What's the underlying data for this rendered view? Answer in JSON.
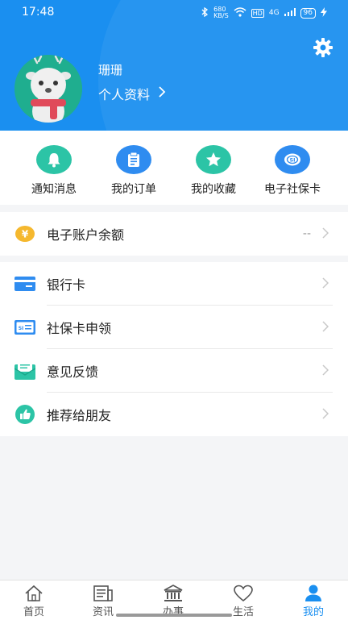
{
  "status_bar": {
    "time": "17:48",
    "network_speed": "680\nKB/S",
    "hd": "HD",
    "signal": "4G",
    "battery": "96"
  },
  "header": {
    "username": "珊珊",
    "profile_link": "个人资料",
    "settings_icon": "gear-icon"
  },
  "quick_actions": [
    {
      "label": "通知消息",
      "icon": "bell-icon",
      "color": "#2cc4a6"
    },
    {
      "label": "我的订单",
      "icon": "clipboard-icon",
      "color": "#2f8cf0"
    },
    {
      "label": "我的收藏",
      "icon": "star-icon",
      "color": "#2cc4a6"
    },
    {
      "label": "电子社保卡",
      "icon": "social-security-card-icon",
      "color": "#2f8cf0"
    }
  ],
  "balance": {
    "label": "电子账户余额",
    "value": "--",
    "icon": "yen-coin-icon"
  },
  "menu": [
    {
      "label": "银行卡",
      "icon": "bank-card-icon"
    },
    {
      "label": "社保卡申领",
      "icon": "social-card-icon"
    },
    {
      "label": "意见反馈",
      "icon": "feedback-envelope-icon"
    },
    {
      "label": "推荐给朋友",
      "icon": "thumbs-up-icon"
    }
  ],
  "tabbar": [
    {
      "label": "首页",
      "icon": "home-icon"
    },
    {
      "label": "资讯",
      "icon": "news-icon"
    },
    {
      "label": "办事",
      "icon": "government-building-icon"
    },
    {
      "label": "生活",
      "icon": "heart-icon"
    },
    {
      "label": "我的",
      "icon": "person-icon",
      "active": true
    }
  ],
  "colors": {
    "primary": "#1a8ff0",
    "accent_green": "#2cc4a6",
    "coin_yellow": "#f5b82e"
  }
}
